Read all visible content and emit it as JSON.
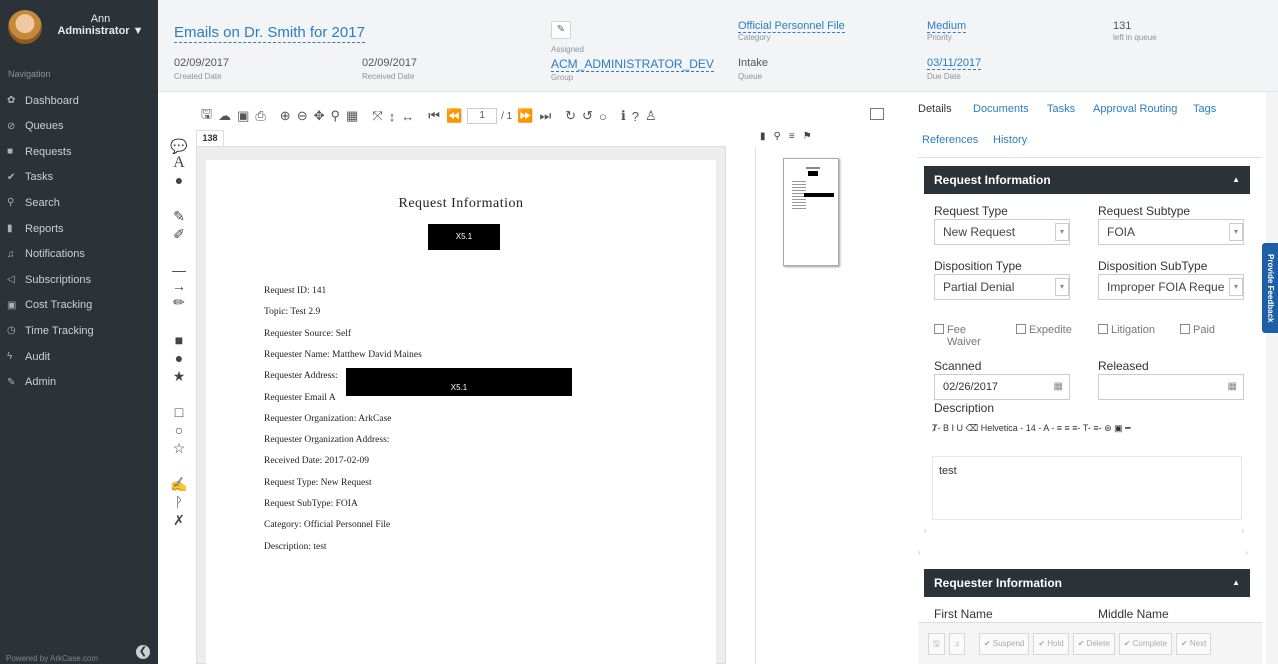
{
  "user": {
    "name": "Ann",
    "role": "Administrator ▼"
  },
  "nav": {
    "title": "Navigation",
    "items": [
      {
        "icon": "✿",
        "label": "Dashboard"
      },
      {
        "icon": "⊘",
        "label": "Queues"
      },
      {
        "icon": "■",
        "label": "Requests"
      },
      {
        "icon": "✔",
        "label": "Tasks"
      },
      {
        "icon": "⚲",
        "label": "Search"
      },
      {
        "icon": "▮",
        "label": "Reports"
      },
      {
        "icon": "♫",
        "label": "Notifications"
      },
      {
        "icon": "◁",
        "label": "Subscriptions"
      },
      {
        "icon": "▣",
        "label": "Cost Tracking"
      },
      {
        "icon": "◷",
        "label": "Time Tracking"
      },
      {
        "icon": "ϟ",
        "label": "Audit"
      },
      {
        "icon": "✎",
        "label": "Admin"
      }
    ],
    "powered": "Powered by ArkCase.com"
  },
  "header": {
    "title": "Emails on Dr. Smith for 2017",
    "created_date": "02/09/2017",
    "created_label": "Created Date",
    "received_date": "02/09/2017",
    "received_label": "Received Date",
    "assigned_label": "Assigned",
    "group": "ACM_ADMINISTRATOR_DEV",
    "group_label": "Group",
    "category": "Official Personnel File",
    "category_label": "Category",
    "queue": "Intake",
    "queue_label": "Queue",
    "priority": "Medium",
    "priority_label": "Priority",
    "due_date": "03/11/2017",
    "due_label": "Due Date",
    "queue_count": "131",
    "queue_count_label": "left in queue"
  },
  "viewer": {
    "page": "1",
    "page_total": "/ 1",
    "doc_tab": "138"
  },
  "document": {
    "title": "Request Information",
    "redaction_label": "X5.1",
    "lines": [
      "Request ID: 141",
      "Topic: Test 2.9",
      "Requester Source: Self",
      "Requester Name: Matthew David Maines",
      "Requester Address:",
      "Requester Email A",
      "Requester Organization: ArkCase",
      "Requester Organization Address:",
      "Received Date: 2017-02-09",
      "Request Type: New Request",
      "Request SubType: FOIA",
      "Category: Official Personnel File",
      "Description: test"
    ]
  },
  "tabs": [
    "Details",
    "Documents",
    "Tasks",
    "Approval Routing",
    "Tags",
    "References",
    "History"
  ],
  "request_info": {
    "title": "Request Information",
    "request_type_label": "Request Type",
    "request_type": "New Request",
    "request_subtype_label": "Request Subtype",
    "request_subtype": "FOIA",
    "disposition_type_label": "Disposition Type",
    "disposition_type": "Partial Denial",
    "disposition_subtype_label": "Disposition SubType",
    "disposition_subtype": "Improper FOIA Reque",
    "fee_waiver": "Fee",
    "fee_waiver2": "Waiver",
    "expedite": "Expedite",
    "litigation": "Litigation",
    "paid": "Paid",
    "scanned_label": "Scanned",
    "scanned": "02/26/2017",
    "released_label": "Released",
    "released": "",
    "description_label": "Description",
    "editor_tools": "Ⱦ- B I U ⌫ Helvetica - 14 - A - ≡ ≡ ≡- T- ≡- ⊛ ▣ ━",
    "description": "test"
  },
  "requester_info": {
    "title": "Requester Information",
    "first_name_label": "First Name",
    "middle_name_label": "Middle Name"
  },
  "actions": {
    "suspend": "✔ Suspend",
    "hold": "✔ Hold",
    "delete": "✔ Delete",
    "complete": "✔ Complete",
    "next": "✔ Next"
  },
  "feedback": "Provide Feedback"
}
